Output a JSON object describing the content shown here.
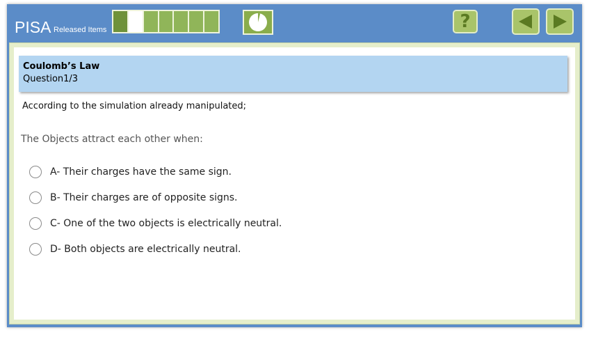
{
  "header": {
    "logo": "PISA",
    "logo_sub": "Released Items",
    "progress": {
      "total_segments": 7,
      "completed": 1,
      "current_index": 1
    },
    "timer": {
      "elapsed_fraction": 0.04
    },
    "help_label": "?",
    "icons": {
      "help": "question-mark-icon",
      "prev": "triangle-left-icon",
      "next": "triangle-right-icon",
      "timer": "clock-pie-icon"
    }
  },
  "question": {
    "title": "Coulomb’s Law",
    "subtitle": "Question1/3",
    "intro": "According to the simulation already manipulated;",
    "prompt": "The Objects attract each other when:",
    "options": [
      {
        "label": "A- Their charges have the same sign."
      },
      {
        "label": "B- Their charges are of opposite signs."
      },
      {
        "label": "C- One of the two objects is electrically neutral."
      },
      {
        "label": "D- Both objects are electrically neutral."
      }
    ]
  },
  "colors": {
    "frame_blue": "#5b8cc8",
    "green_accent": "#90b559",
    "title_bg": "#b3d5f1"
  }
}
